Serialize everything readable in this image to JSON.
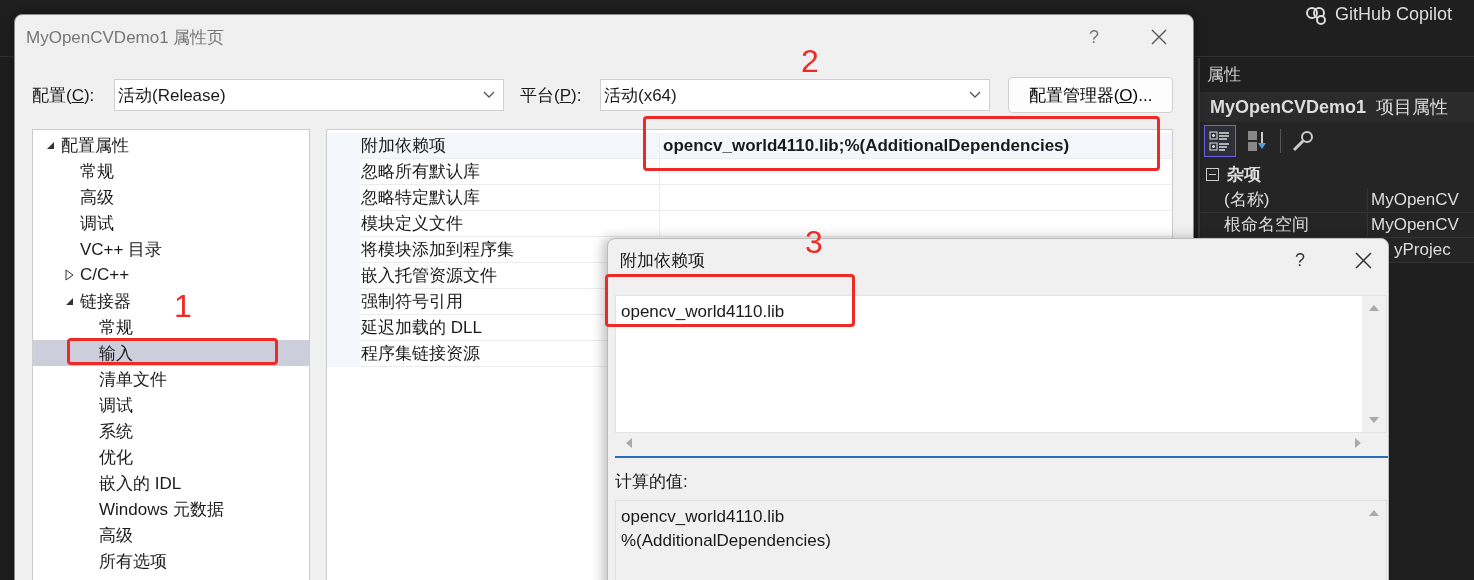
{
  "ide": {
    "copilot_label": "GitHub Copilot",
    "properties_panel": {
      "title": "属性",
      "header_name": "MyOpenCVDemo1",
      "header_suffix": "项目属性",
      "toolbar": [
        {
          "kind": "categorized",
          "selected": true
        },
        {
          "kind": "alphabetical",
          "selected": false
        },
        {
          "kind": "property-pages",
          "selected": false
        }
      ],
      "category": {
        "label": "杂项",
        "expanded": true
      },
      "rows": [
        {
          "name": "(名称)",
          "value": "MyOpenCV"
        },
        {
          "name": "根命名空间",
          "value": "MyOpenCV"
        },
        {
          "value": "yProjec"
        }
      ]
    }
  },
  "dialog": {
    "title": "MyOpenCVDemo1 属性页",
    "help": "?",
    "configuration": {
      "label_before": "配置(",
      "access_key": "C",
      "label_after": "):",
      "value": "活动(Release)"
    },
    "platform": {
      "label_before": "平台(",
      "access_key": "P",
      "label_after": "):",
      "value": "活动(x64)"
    },
    "manager_button": {
      "label_before": "配置管理器(",
      "access_key": "O",
      "label_after": ")..."
    },
    "tree": [
      {
        "label": "配置属性",
        "expanded": true,
        "selected": false,
        "children": [
          {
            "label": "常规",
            "selected": false
          },
          {
            "label": "高级",
            "selected": false
          },
          {
            "label": "调试",
            "selected": false
          },
          {
            "label": "VC++ 目录",
            "selected": false
          },
          {
            "label": "C/C++",
            "expanded": false,
            "selected": false
          },
          {
            "label": "链接器",
            "expanded": true,
            "selected": false,
            "children": [
              {
                "label": "常规",
                "selected": false
              },
              {
                "label": "输入",
                "selected": true
              },
              {
                "label": "清单文件",
                "selected": false
              },
              {
                "label": "调试",
                "selected": false
              },
              {
                "label": "系统",
                "selected": false
              },
              {
                "label": "优化",
                "selected": false
              },
              {
                "label": "嵌入的 IDL",
                "selected": false
              },
              {
                "label": "Windows 元数据",
                "selected": false
              },
              {
                "label": "高级",
                "selected": false
              },
              {
                "label": "所有选项",
                "selected": false
              }
            ]
          }
        ]
      }
    ],
    "grid": [
      {
        "name": "附加依赖项",
        "value": "opencv_world4110.lib;%(AdditionalDependencies)",
        "value_bold": true,
        "selected": true
      },
      {
        "name": "忽略所有默认库",
        "selected": false
      },
      {
        "name": "忽略特定默认库",
        "selected": false
      },
      {
        "name": "模块定义文件",
        "selected": false
      },
      {
        "name": "将模块添加到程序集",
        "selected": false
      },
      {
        "name": "嵌入托管资源文件",
        "selected": false
      },
      {
        "name": "强制符号引用",
        "selected": false
      },
      {
        "name": "延迟加载的 DLL",
        "selected": false
      },
      {
        "name": "程序集链接资源",
        "selected": false
      }
    ]
  },
  "subdialog": {
    "title": "附加依赖项",
    "help": "?",
    "entries": [
      "opencv_world4110.lib"
    ],
    "computed_label": "计算的值:",
    "computed_lines": [
      "opencv_world4110.lib",
      "%(AdditionalDependencies)"
    ]
  },
  "annotations": [
    {
      "label": "1"
    },
    {
      "label": "2"
    },
    {
      "label": "3"
    }
  ]
}
